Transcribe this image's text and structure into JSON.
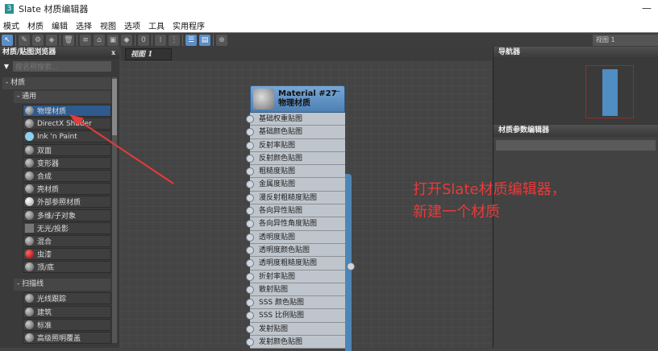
{
  "window": {
    "title": "Slate 材质编辑器",
    "icon_text": "3",
    "minimize": "—"
  },
  "menu": [
    "模式",
    "材质",
    "编辑",
    "选择",
    "视图",
    "选项",
    "工具",
    "实用程序"
  ],
  "toolbar": {
    "view_tab": "视图 1"
  },
  "browser": {
    "title": "材质/贴图浏览器",
    "close": "x",
    "search_placeholder": "按名称搜索...",
    "group": "- 材质",
    "general": {
      "label": "- 通用",
      "items": [
        {
          "label": "物理材质",
          "swatch": "sphere",
          "selected": true
        },
        {
          "label": "DirectX Shader",
          "swatch": "sphere"
        },
        {
          "label": "Ink 'n Paint",
          "swatch": "light"
        },
        {
          "label": "双面",
          "swatch": "sphere"
        },
        {
          "label": "变形器",
          "swatch": "sphere"
        },
        {
          "label": "合成",
          "swatch": "sphere"
        },
        {
          "label": "壳材质",
          "swatch": "sphere"
        },
        {
          "label": "外部参照材质",
          "swatch": "white"
        },
        {
          "label": "多维/子对象",
          "swatch": "sphere"
        },
        {
          "label": "无光/投影",
          "swatch": "flat"
        },
        {
          "label": "混合",
          "swatch": "sphere"
        },
        {
          "label": "虫漆",
          "swatch": "red"
        },
        {
          "label": "顶/底",
          "swatch": "sphere"
        }
      ]
    },
    "scanline": {
      "label": "- 扫描线",
      "items": [
        {
          "label": "光线跟踪",
          "swatch": "sphere"
        },
        {
          "label": "建筑",
          "swatch": "sphere"
        },
        {
          "label": "标准",
          "swatch": "sphere"
        },
        {
          "label": "高级照明覆盖",
          "swatch": "sphere"
        }
      ]
    }
  },
  "view": {
    "tab": "视图 1",
    "node": {
      "name": "Material #27",
      "type": "物理材质",
      "collapse": "—",
      "slots": [
        "基础权重贴图",
        "基础颜色贴图",
        "反射率贴图",
        "反射颜色贴图",
        "粗糙度贴图",
        "金属度贴图",
        "漫反射粗糙度贴图",
        "各向异性贴图",
        "各向异性角度贴图",
        "透明度贴图",
        "透明度颜色贴图",
        "透明度粗糙度贴图",
        "折射率贴图",
        "散射贴图",
        "SSS 颜色贴图",
        "SSS 比例贴图",
        "发射贴图",
        "发射颜色贴图"
      ]
    }
  },
  "navigator": {
    "title": "导航器"
  },
  "params": {
    "title": "材质参数编辑器"
  },
  "annotation": {
    "line1": "打开Slate材质编辑器，",
    "line2": "新建一个材质",
    "color": "#e83a3a"
  }
}
